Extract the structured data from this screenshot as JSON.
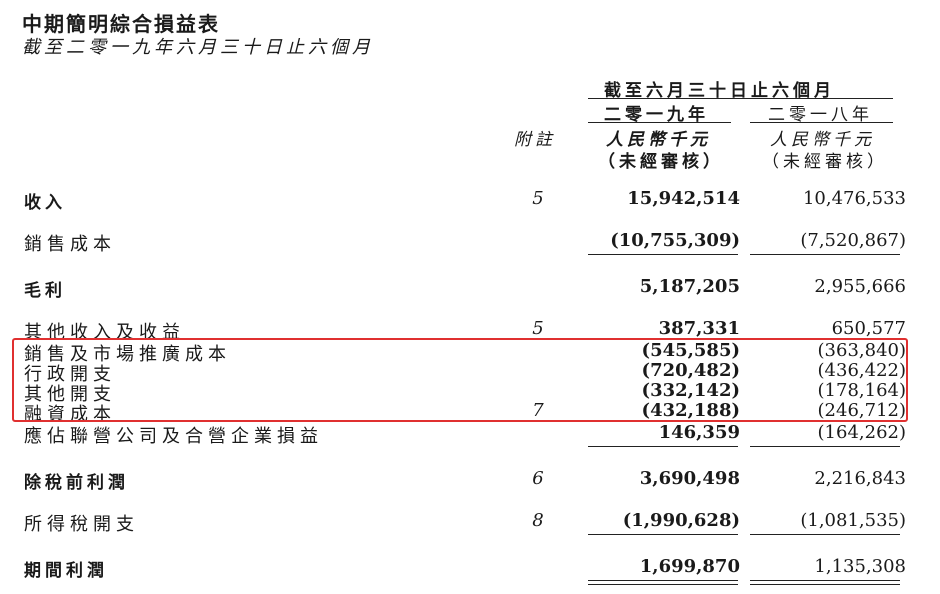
{
  "title": "中期簡明綜合損益表",
  "subtitle": "截至二零一九年六月三十日止六個月",
  "header": {
    "period": "截至六月三十日止六個月",
    "note_label": "附註",
    "col1": {
      "year": "二零一九年",
      "unit": "人民幣千元",
      "audit": "（未經審核）"
    },
    "col2": {
      "year": "二零一八年",
      "unit": "人民幣千元",
      "audit": "（未經審核）"
    }
  },
  "rows": [
    {
      "label": "收入",
      "note": "5",
      "v2019": "15,942,514",
      "v2018": "10,476,533"
    },
    {
      "label": "銷售成本",
      "note": "",
      "v2019": "(10,755,309)",
      "v2018": "(7,520,867)"
    },
    {
      "label": "毛利",
      "note": "",
      "v2019": "5,187,205",
      "v2018": "2,955,666"
    },
    {
      "label": "其他收入及收益",
      "note": "5",
      "v2019": "387,331",
      "v2018": "650,577"
    },
    {
      "label": "銷售及市場推廣成本",
      "note": "",
      "v2019": "(545,585)",
      "v2018": "(363,840)"
    },
    {
      "label": "行政開支",
      "note": "",
      "v2019": "(720,482)",
      "v2018": "(436,422)"
    },
    {
      "label": "其他開支",
      "note": "",
      "v2019": "(332,142)",
      "v2018": "(178,164)"
    },
    {
      "label": "融資成本",
      "note": "7",
      "v2019": "(432,188)",
      "v2018": "(246,712)"
    },
    {
      "label": "應佔聯營公司及合營企業損益",
      "note": "",
      "v2019": "146,359",
      "v2018": "(164,262)"
    },
    {
      "label": "除稅前利潤",
      "note": "6",
      "v2019": "3,690,498",
      "v2018": "2,216,843"
    },
    {
      "label": "所得稅開支",
      "note": "8",
      "v2019": "(1,990,628)",
      "v2018": "(1,081,535)"
    },
    {
      "label": "期間利潤",
      "note": "",
      "v2019": "1,699,870",
      "v2018": "1,135,308"
    }
  ]
}
